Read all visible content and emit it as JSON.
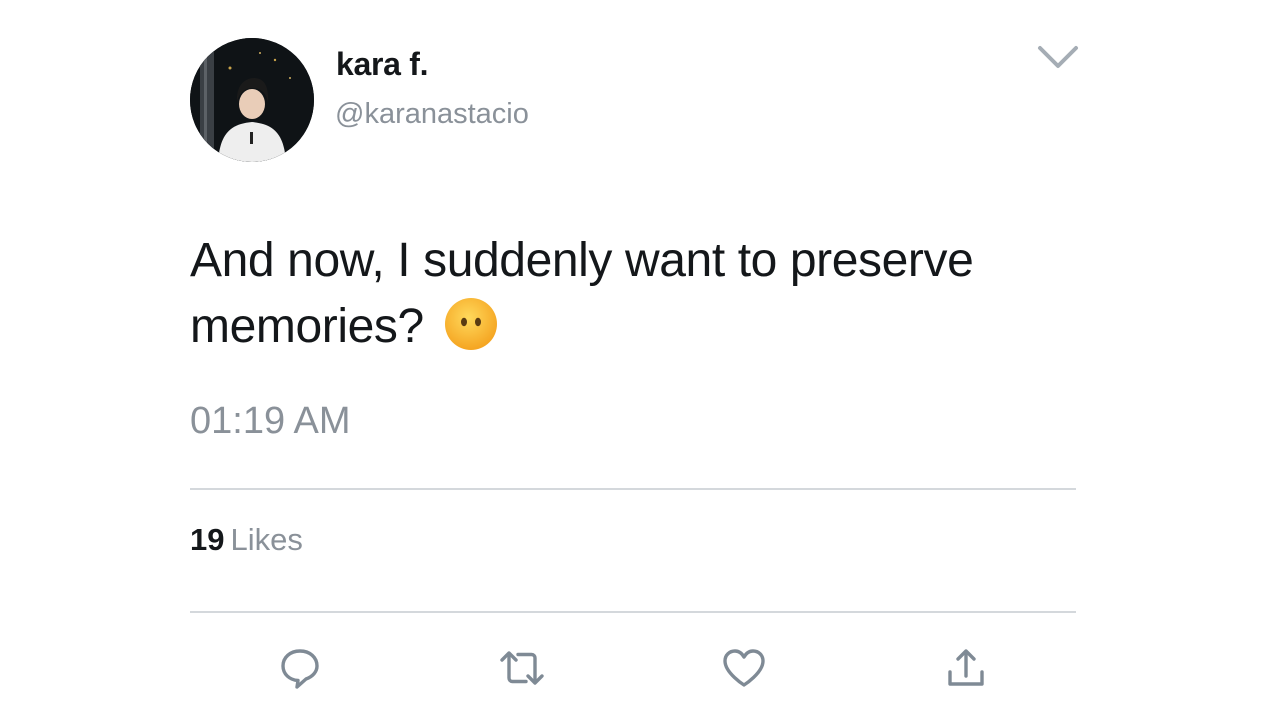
{
  "author": {
    "display_name": "kara f.",
    "handle": "@karanastacio"
  },
  "tweet": {
    "text": "And now, I suddenly want to preserve memories?",
    "emoji": "face-without-mouth-emoji",
    "timestamp": "01:19 AM"
  },
  "stats": {
    "likes_count": "19",
    "likes_label": "Likes"
  },
  "icons": {
    "menu": "chevron-down-icon",
    "reply": "reply-icon",
    "retweet": "retweet-icon",
    "like": "heart-icon",
    "share": "share-icon"
  },
  "colors": {
    "text_primary": "#14171a",
    "text_secondary": "#8a9199",
    "icon": "#7f8a95",
    "divider": "#d4d8dc",
    "emoji_yellow": "#ffcc4d"
  }
}
